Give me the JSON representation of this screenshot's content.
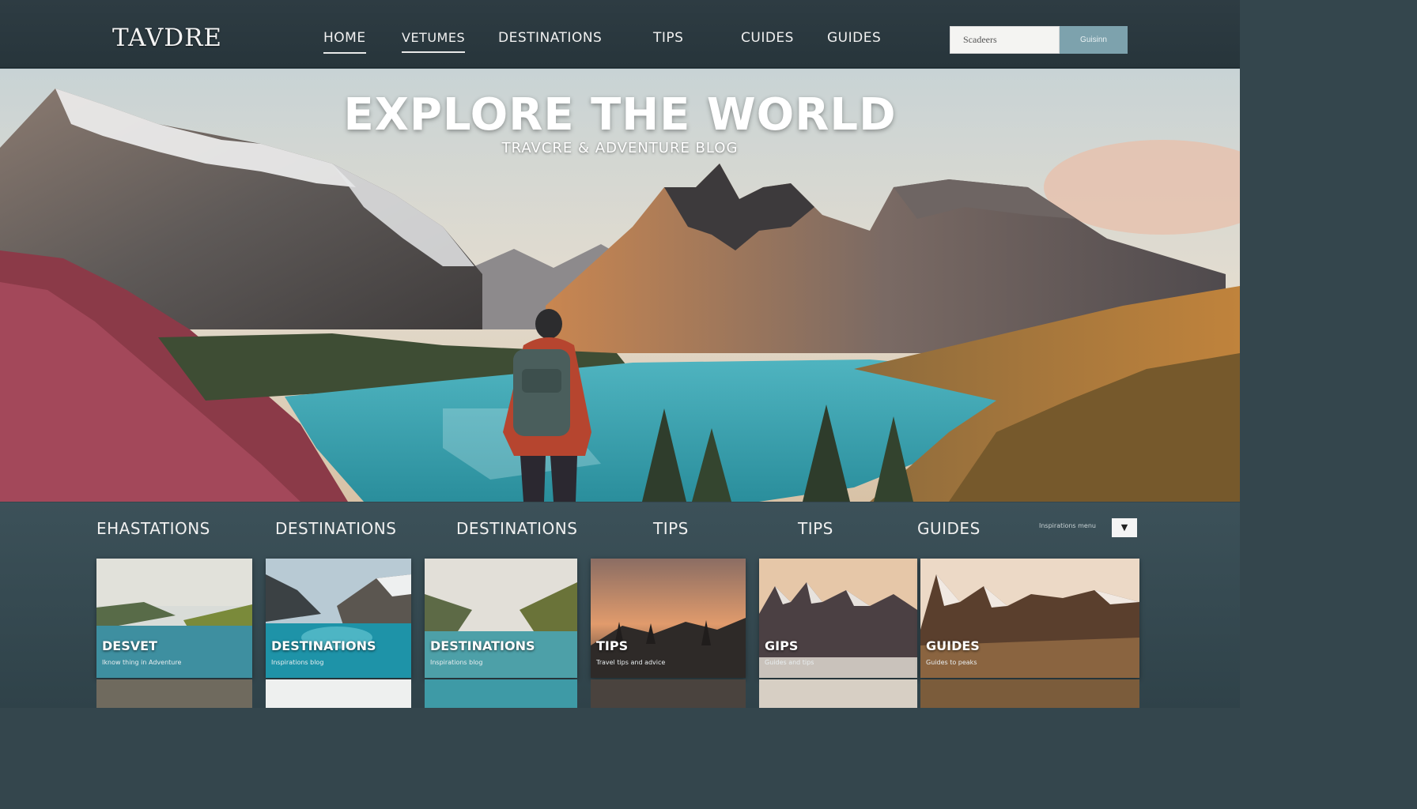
{
  "header": {
    "logo": "TAVDRE",
    "nav": [
      {
        "label": "HOME",
        "active": true
      },
      {
        "label": "VETUMES"
      },
      {
        "label": "DESTINATIONS"
      },
      {
        "label": "TIPS"
      },
      {
        "label": "CUIDES"
      },
      {
        "label": "GUIDES"
      }
    ],
    "search_placeholder": "Scadeers",
    "search_button": "Guisinn"
  },
  "hero": {
    "title": "EXPLORE THE WORLD",
    "subtitle": "TRAVCRE & ADVENTURE BLOG"
  },
  "categories": {
    "links": [
      "EHASTATIONS",
      "DESTINATIONS",
      "DESTINATIONS",
      "TIPS",
      "TIPS",
      "GUIDES"
    ],
    "filter_label": "Inspirations menu",
    "filter_icon": "chevron-down-icon"
  },
  "cards": [
    {
      "title": "DESVET",
      "caption": "Iknow thing in Adventure"
    },
    {
      "title": "DESTINATIONS",
      "caption": "Inspirations blog"
    },
    {
      "title": "DESTINATIONS",
      "caption": "Inspirations blog"
    },
    {
      "title": "TIPS",
      "caption": "Travel tips and advice"
    },
    {
      "title": "GIPS",
      "caption": "Guides and tips"
    },
    {
      "title": "GUIDES",
      "caption": "Guides to peaks"
    }
  ],
  "colors": {
    "topbar": "#2e3c43",
    "search_button": "#7da2ad",
    "category_band": "#3c5159"
  }
}
